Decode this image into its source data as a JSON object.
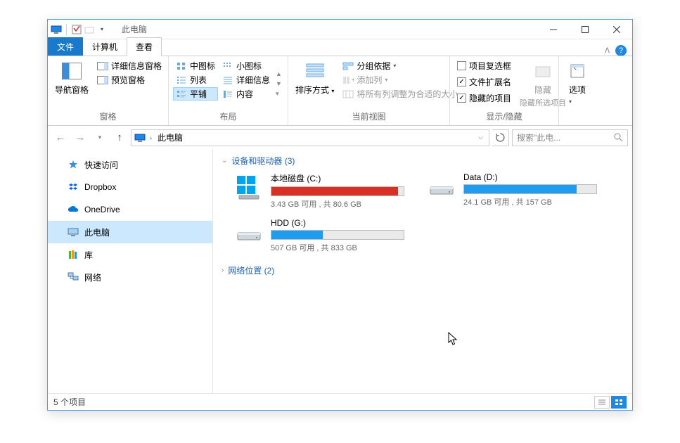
{
  "title": "此电脑",
  "tabs": {
    "file": "文件",
    "computer": "计算机",
    "view": "查看"
  },
  "ribbon": {
    "panes": {
      "nav_pane": "导航窗格",
      "preview_pane": "预览窗格",
      "details_pane": "详细信息窗格",
      "group_label": "窗格"
    },
    "layout": {
      "medium_icons": "中图标",
      "small_icons": "小图标",
      "list": "列表",
      "details": "详细信息",
      "tiles": "平铺",
      "content": "内容",
      "group_label": "布局"
    },
    "current_view": {
      "sort_by": "排序方式",
      "group_by": "分组依据",
      "add_columns": "添加列",
      "fit_columns": "将所有列调整为合适的大小",
      "group_label": "当前视图"
    },
    "show_hide": {
      "item_checkboxes": "项目复选框",
      "file_ext": "文件扩展名",
      "hidden_items": "隐藏的项目",
      "hide_selected": "隐藏所选项目",
      "hide_btn": "隐藏",
      "group_label": "显示/隐藏"
    },
    "options": "选项"
  },
  "address": {
    "crumb": "此电脑",
    "search_placeholder": "搜索\"此电..."
  },
  "sidebar": {
    "quick_access": "快速访问",
    "dropbox": "Dropbox",
    "onedrive": "OneDrive",
    "this_pc": "此电脑",
    "libraries": "库",
    "network": "网络"
  },
  "content": {
    "devices_header": "设备和驱动器 (3)",
    "network_header": "网络位置 (2)",
    "drives": [
      {
        "name": "本地磁盘 (C:)",
        "stat": "3.43 GB 可用 , 共 80.6 GB",
        "fill_pct": 96,
        "color": "#d93025",
        "os": true
      },
      {
        "name": "Data (D:)",
        "stat": "24.1 GB 可用 , 共 157 GB",
        "fill_pct": 85,
        "color": "#1e9df0",
        "os": false
      },
      {
        "name": "HDD (G:)",
        "stat": "507 GB 可用 , 共 833 GB",
        "fill_pct": 39,
        "color": "#1e9df0",
        "os": false
      }
    ]
  },
  "status": {
    "items": "5 个项目"
  }
}
